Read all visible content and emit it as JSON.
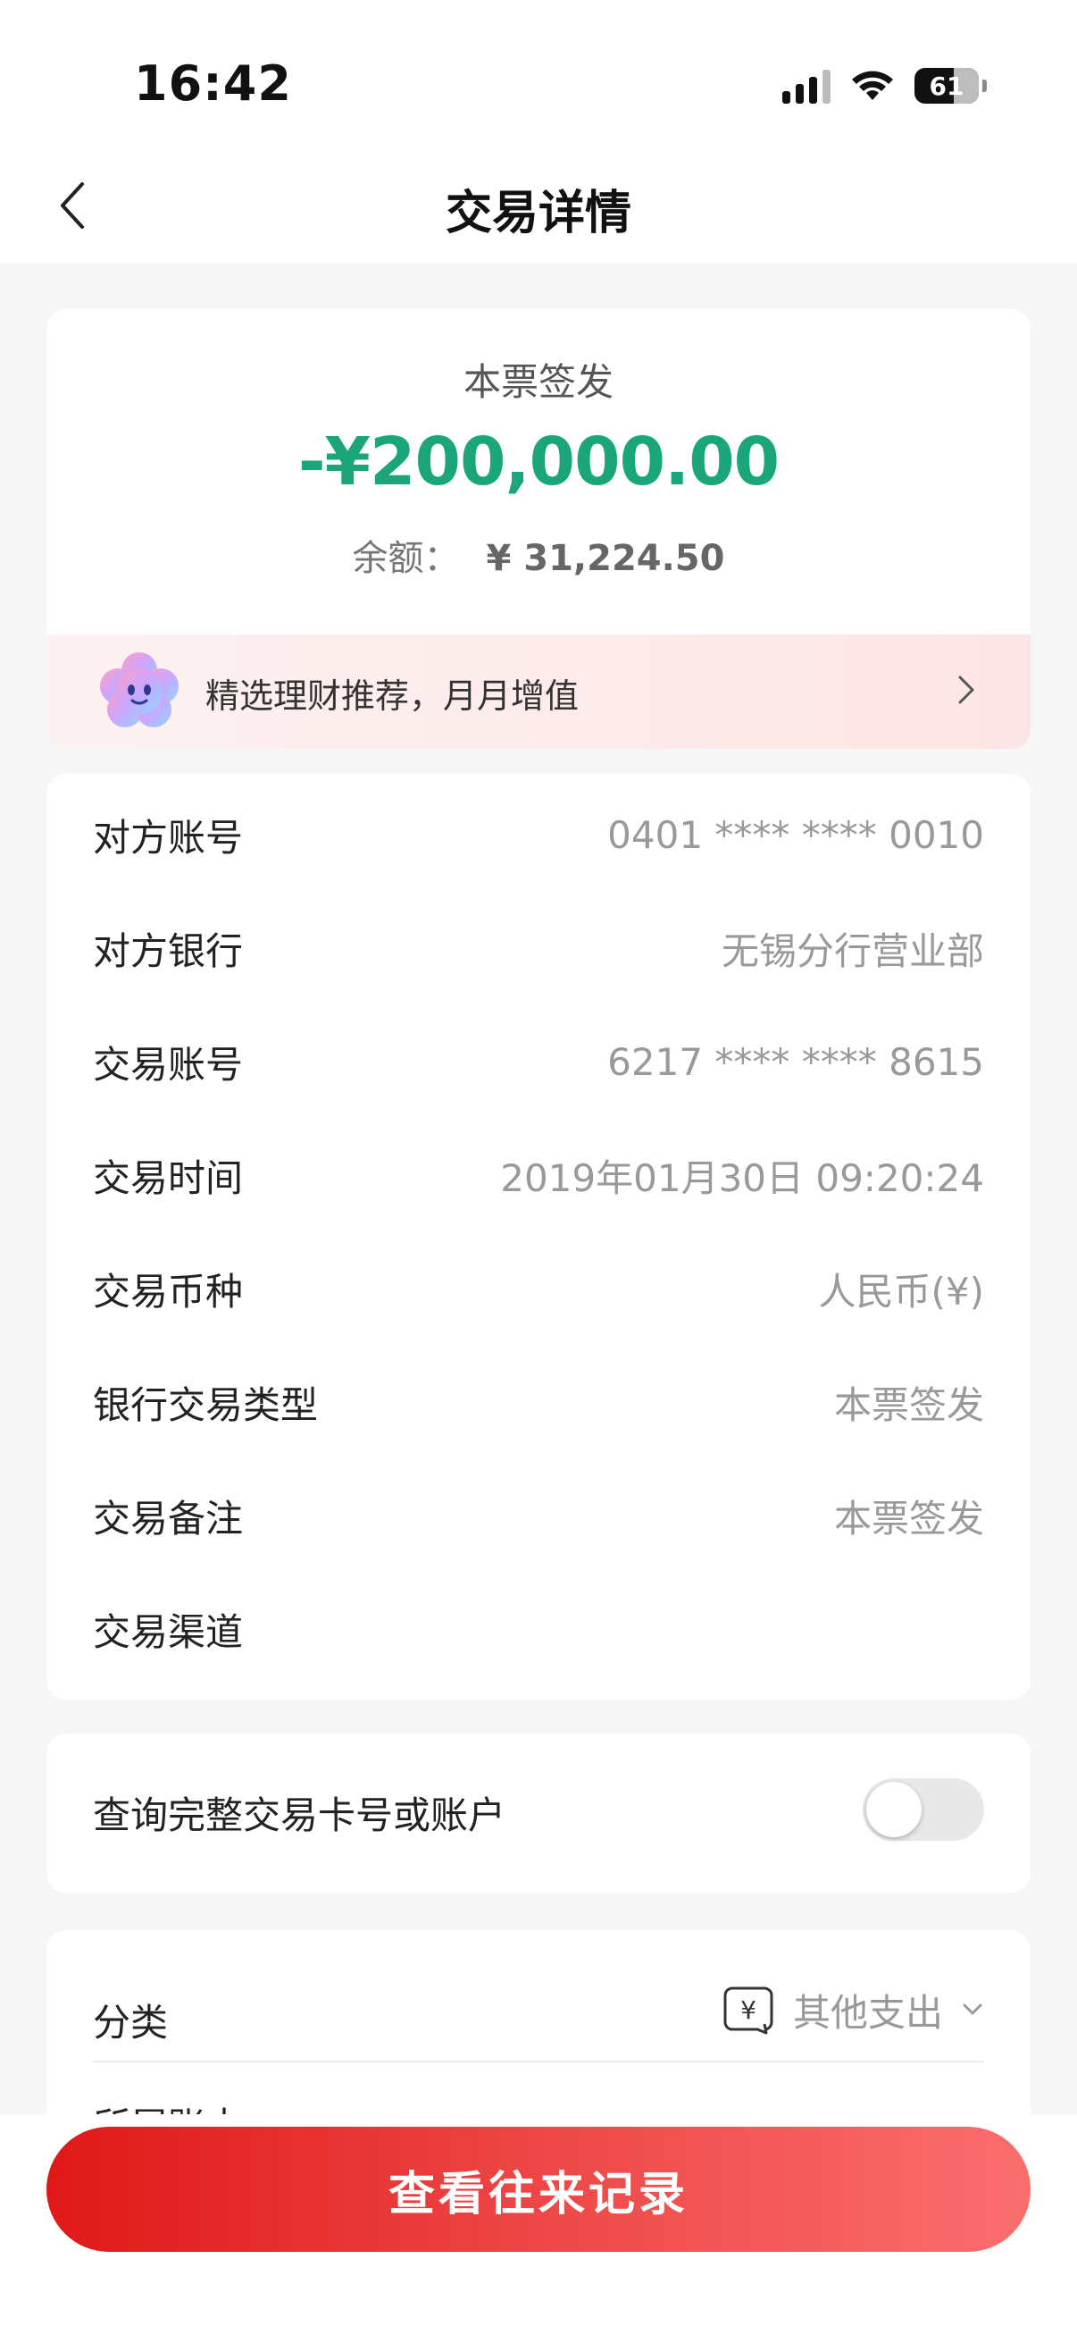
{
  "status_bar": {
    "time": "16:42",
    "battery": "61"
  },
  "nav": {
    "title": "交易详情"
  },
  "summary": {
    "type": "本票签发",
    "amount": "-¥200,000.00",
    "balance_label": "余额：",
    "balance_value": "¥ 31,224.50",
    "amount_color": "#1aa67a"
  },
  "promo": {
    "text": "精选理财推荐，月月增值"
  },
  "details": [
    {
      "label": "对方账号",
      "value": "0401 **** **** 0010"
    },
    {
      "label": "对方银行",
      "value": "无锡分行营业部"
    },
    {
      "label": "交易账号",
      "value": "6217 **** **** 8615"
    },
    {
      "label": "交易时间",
      "value": "2019年01月30日 09:20:24"
    },
    {
      "label": "交易币种",
      "value": "人民币(¥)"
    },
    {
      "label": "银行交易类型",
      "value": "本票签发"
    },
    {
      "label": "交易备注",
      "value": "本票签发"
    },
    {
      "label": "交易渠道",
      "value": ""
    }
  ],
  "toggle": {
    "label": "查询完整交易卡号或账户",
    "state": "off"
  },
  "category": {
    "label": "分类",
    "value": "其他支出",
    "next_label": "所属账本"
  },
  "cta": {
    "label": "查看往来记录",
    "color": "#e01818"
  }
}
